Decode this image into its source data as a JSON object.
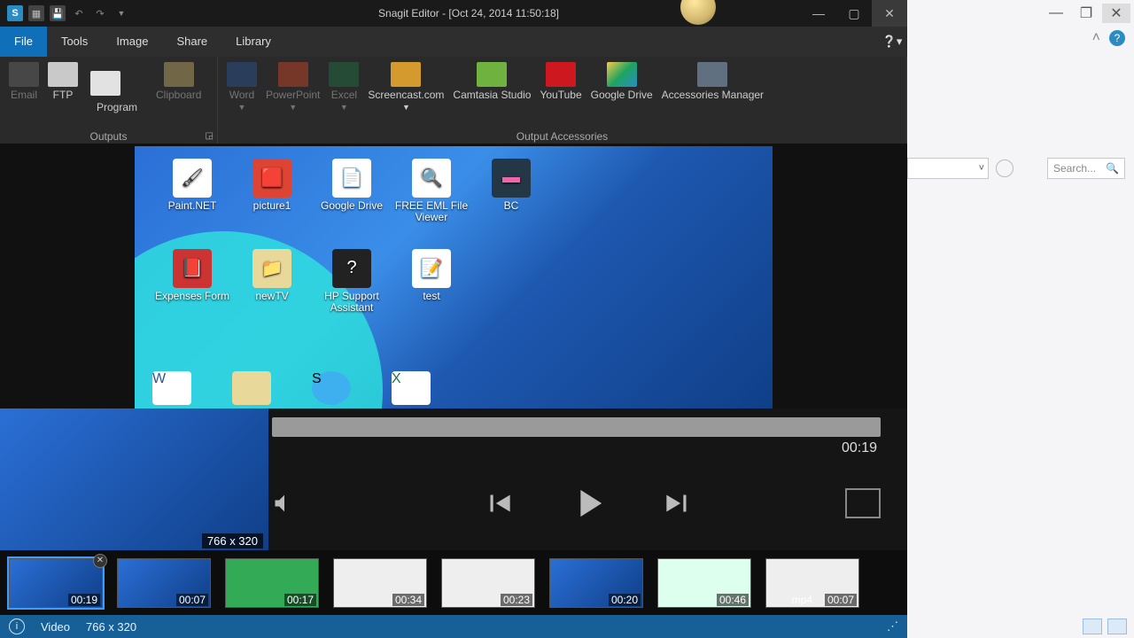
{
  "titlebar": {
    "title": "Snagit Editor - [Oct 24, 2014 11:50:18]"
  },
  "menus": {
    "file": "File",
    "tools": "Tools",
    "image": "Image",
    "share": "Share",
    "library": "Library"
  },
  "ribbon": {
    "outputs": {
      "name": "Outputs",
      "email": "Email",
      "ftp": "FTP",
      "program": "Program",
      "clipboard": "Clipboard"
    },
    "accessories": {
      "name": "Output Accessories",
      "word": "Word",
      "ppt": "PowerPoint",
      "excel": "Excel",
      "sc": "Screencast.com",
      "ct": "Camtasia Studio",
      "yt": "YouTube",
      "gd": "Google Drive",
      "am": "Accessories Manager"
    }
  },
  "desktop_icons": {
    "r1": [
      "Paint.NET",
      "picture1",
      "Google Drive",
      "FREE EML File Viewer",
      "BC"
    ],
    "r2": [
      "Expenses Form",
      "newTV",
      "HP Support Assistant",
      "test"
    ]
  },
  "player": {
    "time": "00:19",
    "dim": "766 x 320"
  },
  "tray": [
    {
      "ts": "00:19"
    },
    {
      "ts": "00:07"
    },
    {
      "ts": "00:17"
    },
    {
      "ts": "00:34"
    },
    {
      "ts": "00:23"
    },
    {
      "ts": "00:20"
    },
    {
      "ts": "00:46"
    },
    {
      "ts": "00:07",
      "pre": "mp4"
    }
  ],
  "status": {
    "type": "Video",
    "dim": "766 x 320"
  },
  "rightpane": {
    "search": "Search..."
  }
}
